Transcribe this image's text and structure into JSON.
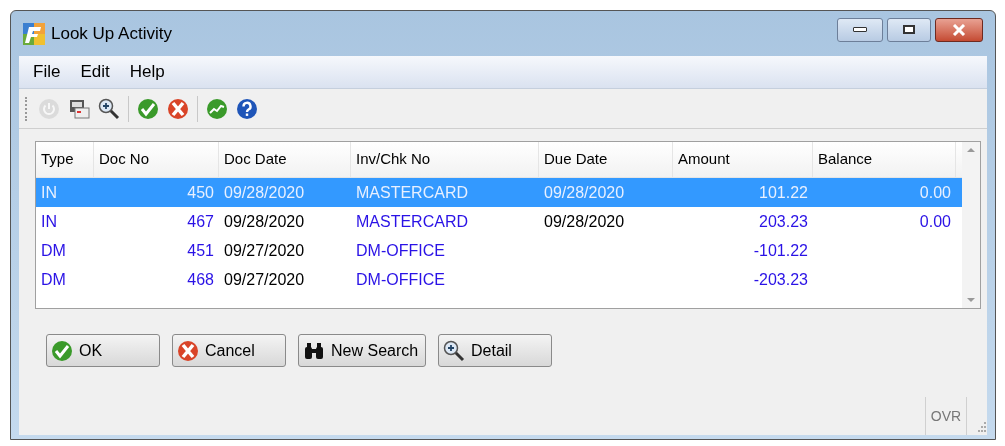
{
  "window": {
    "title": "Look Up Activity"
  },
  "menu": [
    "File",
    "Edit",
    "Help"
  ],
  "toolbar": [
    {
      "kind": "power",
      "disabled": true
    },
    {
      "kind": "print",
      "disabled": false
    },
    {
      "kind": "zoom",
      "disabled": false
    },
    {
      "kind": "ok",
      "disabled": false
    },
    {
      "kind": "cancel",
      "disabled": false
    },
    {
      "kind": "chart",
      "disabled": false
    },
    {
      "kind": "help",
      "disabled": false
    }
  ],
  "table": {
    "columns": [
      "Type",
      "Doc No",
      "Doc Date",
      "Inv/Chk No",
      "Due Date",
      "Amount",
      "Balance"
    ],
    "rows": [
      {
        "selected": true,
        "cells": [
          "IN",
          "450",
          "09/28/2020",
          "MASTERCARD",
          "09/28/2020",
          "101.22",
          "0.00"
        ]
      },
      {
        "selected": false,
        "cells": [
          "IN",
          "467",
          "09/28/2020",
          "MASTERCARD",
          "09/28/2020",
          "203.23",
          "0.00"
        ]
      },
      {
        "selected": false,
        "cells": [
          "DM",
          "451",
          "09/27/2020",
          "DM-OFFICE",
          "",
          "-101.22",
          ""
        ]
      },
      {
        "selected": false,
        "cells": [
          "DM",
          "468",
          "09/27/2020",
          "DM-OFFICE",
          "",
          "-203.23",
          ""
        ]
      }
    ]
  },
  "buttons": [
    {
      "kind": "ok",
      "label": "OK"
    },
    {
      "kind": "cancel",
      "label": "Cancel"
    },
    {
      "kind": "search",
      "label": "New Search"
    },
    {
      "kind": "zoom",
      "label": "Detail"
    }
  ],
  "status_bar": {
    "mode": "OVR"
  }
}
